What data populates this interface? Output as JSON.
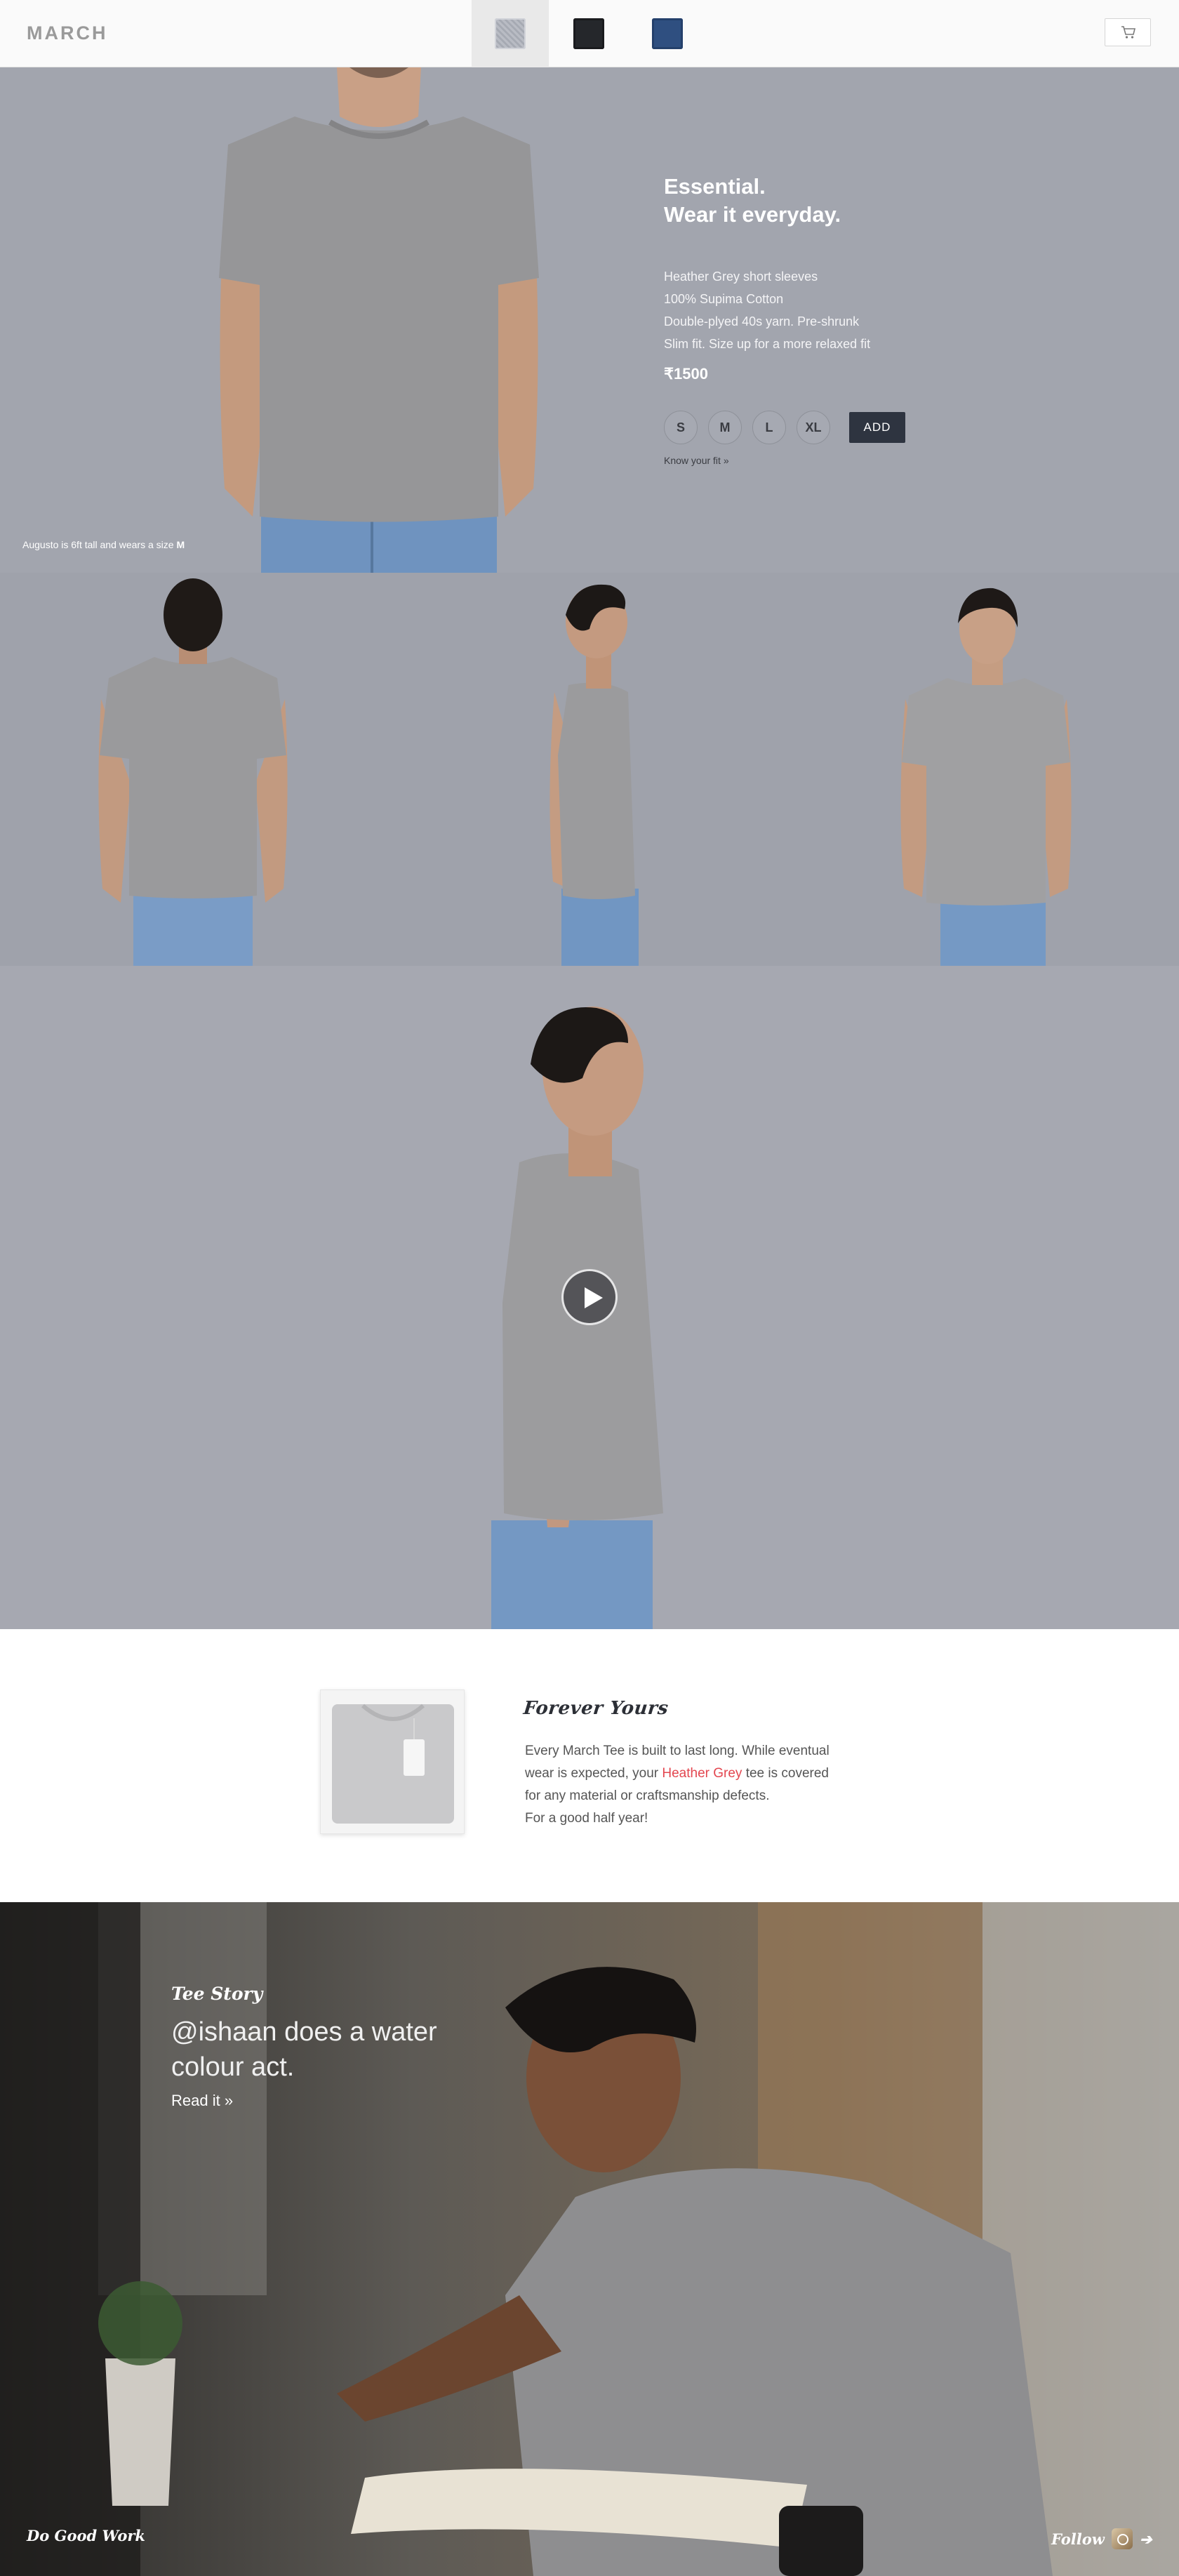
{
  "header": {
    "logo": "MARCH",
    "swatches": [
      {
        "name": "Heather Grey",
        "color": "#b1b4bd",
        "active": true
      },
      {
        "name": "Black",
        "color": "#25272b",
        "active": false
      },
      {
        "name": "Navy",
        "color": "#2f4f80",
        "active": false
      }
    ],
    "cart_icon": "cart-icon"
  },
  "hero": {
    "tagline_line1": "Essential.",
    "tagline_line2": "Wear it everyday.",
    "features": [
      "Heather Grey short sleeves",
      "100% Supima Cotton",
      "Double-plyed 40s yarn. Pre-shrunk",
      "Slim fit. Size up for a more relaxed fit"
    ],
    "price": "₹1500",
    "sizes": [
      "S",
      "M",
      "L",
      "XL"
    ],
    "add_label": "ADD",
    "fit_link": "Know your fit »",
    "fit_caption_prefix": "Augusto is 6ft tall and wears a size",
    "fit_caption_size": "M"
  },
  "video": {
    "play_icon": "play-icon"
  },
  "forever": {
    "title": "Forever Yours",
    "line1": "Every March Tee is built to last long. While eventual",
    "line2_prefix": "wear is expected, your",
    "line2_highlight": "Heather Grey",
    "line2_suffix": "tee is covered",
    "line3": "for any material or craftsmanship defects.",
    "line4": "For a good half year!"
  },
  "story": {
    "kicker": "Tee Story",
    "title": "@ishaan does a water colour act.",
    "link": "Read it »",
    "do_good": "Do Good Work",
    "follow": "Follow"
  },
  "colors": {
    "accent": "#e3464f",
    "dark": "#2e3440",
    "hero_bg": "#a2a5ae"
  }
}
